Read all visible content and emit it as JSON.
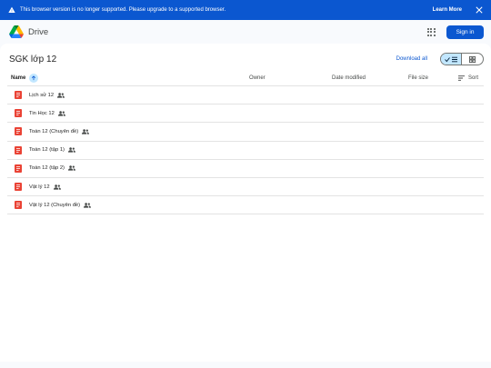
{
  "banner": {
    "message": "This browser version is no longer supported. Please upgrade to a supported browser.",
    "learn_more": "Learn More"
  },
  "app": {
    "name": "Drive"
  },
  "header": {
    "sign_in": "Sign in"
  },
  "folder": {
    "title": "SGK lớp 12",
    "download_all": "Download all"
  },
  "columns": {
    "name": "Name",
    "owner": "Owner",
    "date_modified": "Date modified",
    "file_size": "File size",
    "sort": "Sort"
  },
  "files": [
    {
      "name": "Lịch sử 12"
    },
    {
      "name": "Tin Học 12"
    },
    {
      "name": "Toán 12 (Chuyên đề)"
    },
    {
      "name": "Toán 12 (tập 1)"
    },
    {
      "name": "Toán 12 (tập 2)"
    },
    {
      "name": "Vật lý 12"
    },
    {
      "name": "Vật lý 12 (Chuyên đề)"
    }
  ],
  "colors": {
    "accent": "#0b57d0",
    "toggle_active": "#c2e7ff",
    "pdf": "#ea4335"
  },
  "icons": [
    "warning-icon",
    "close-icon",
    "drive-logo-icon",
    "apps-grid-icon",
    "arrow-up-icon",
    "check-icon",
    "list-view-icon",
    "grid-view-icon",
    "sort-icon",
    "pdf-file-icon",
    "shared-people-icon"
  ]
}
